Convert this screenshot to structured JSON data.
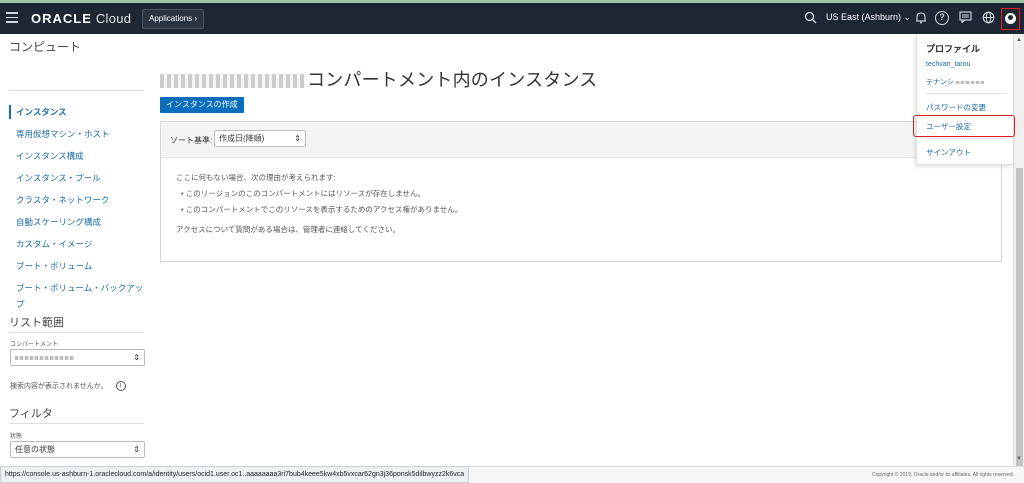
{
  "header": {
    "brand_bold": "ORACLE",
    "brand_light": "Cloud",
    "applications_label": "Applications",
    "region_label": "US East (Ashburn)",
    "icons": [
      "hamburger-icon",
      "search-icon",
      "bell-icon",
      "help-icon",
      "chat-icon",
      "globe-icon",
      "user-icon"
    ]
  },
  "sidebar": {
    "title": "コンピュート",
    "items": [
      {
        "label": "インスタンス",
        "active": true
      },
      {
        "label": "専用仮想マシン・ホスト"
      },
      {
        "label": "インスタンス構成"
      },
      {
        "label": "インスタンス・プール"
      },
      {
        "label": "クラスタ・ネットワーク"
      },
      {
        "label": "自動スケーリング構成"
      },
      {
        "label": "カスタム・イメージ"
      },
      {
        "label": "ブート・ボリューム"
      },
      {
        "label": "ブート・ボリューム・バックアップ"
      }
    ],
    "list_scope_title": "リスト範囲",
    "compartment_label": "コンパートメント",
    "search_help": "検索内容が表示されませんか。",
    "filter_title": "フィルタ",
    "state_label": "状態",
    "state_value": "任意の状態"
  },
  "main": {
    "title": "コンパートメント内のインスタンス",
    "create_button": "インスタンスの作成",
    "sort_label": "ソート基準:",
    "sort_value": "作成日(降順)",
    "empty_intro": "ここに何もない場合、次の理由が考えられます:",
    "empty_reasons": [
      "このリージョンのこのコンパートメントにはリソースが存在しません。",
      "このコンパートメントでこのリソースを表示するためのアクセス権がありません。"
    ],
    "empty_contact": "アクセスについて質問がある場合は、管理者に連絡してください。"
  },
  "profile_menu": {
    "title": "プロファイル",
    "username": "techvan_tarou",
    "tenancy_label": "テナンシ",
    "change_password": "パスワードの変更",
    "user_settings": "ユーザー設定",
    "sign_out": "サインアウト"
  },
  "status": {
    "url": "https://console.us-ashburn-1.oraclecloud.com/a/identity/users/ocid1.user.oc1..aaaaaaaa3ri7bub4keee5kw4xb5vxcar62gn3j36ponsk5dilbwyzz2k6vca",
    "copyright": "Copyright © 2019, Oracle and/or its affiliates. All rights reserved."
  },
  "colors": {
    "topbar": "#1d2733",
    "link": "#1a6ba8",
    "primary_button": "#0a6ebd",
    "highlight": "#d62222"
  }
}
